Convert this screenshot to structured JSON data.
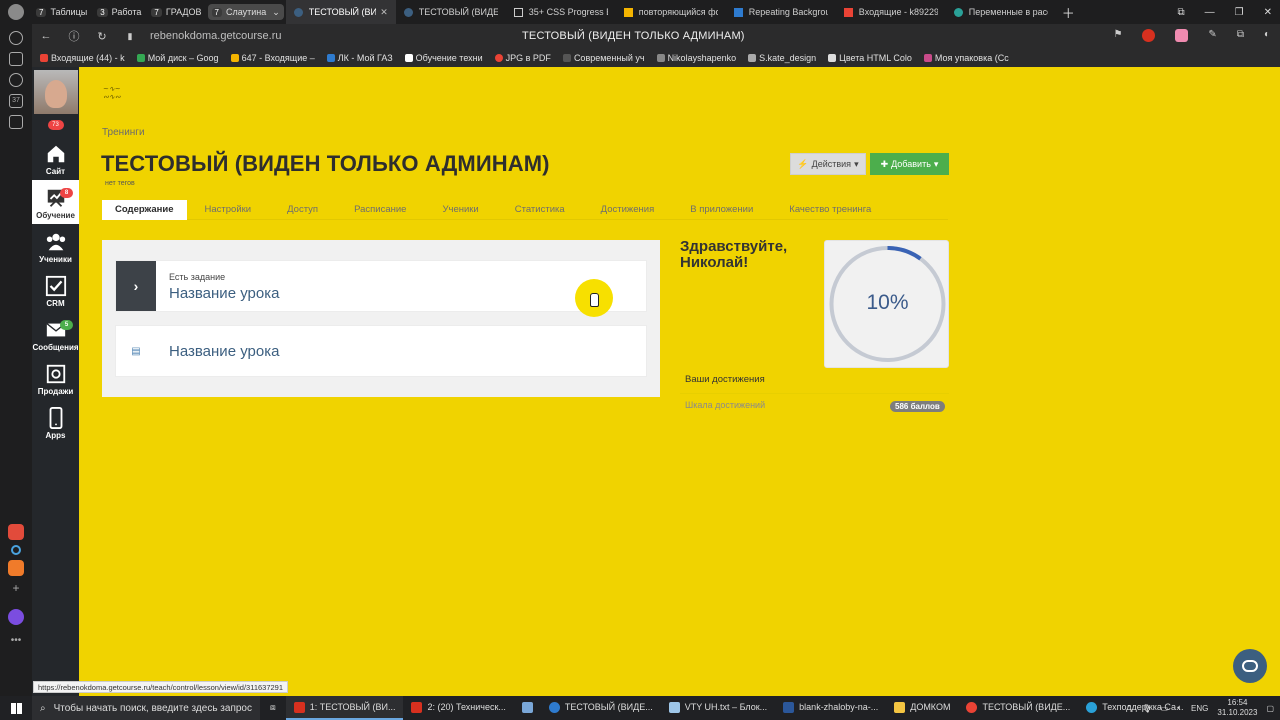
{
  "browser": {
    "tab_groups": [
      {
        "num": "7",
        "label": "Таблицы"
      },
      {
        "num": "3",
        "label": "Работа"
      },
      {
        "num": "7",
        "label": "ГРАДОВ"
      },
      {
        "num": "7",
        "label": "Слаутина"
      }
    ],
    "tabs": [
      {
        "title": "ТЕСТОВЫЙ (ВИД",
        "active": true,
        "color": "#3c5f80"
      },
      {
        "title": "ТЕСТОВЫЙ (ВИДЕН",
        "active": false,
        "color": "#3c5f80"
      },
      {
        "title": "35+ CSS Progress Ba",
        "active": false,
        "color": "#cccccc"
      },
      {
        "title": "повторяющийся фо",
        "active": false,
        "color": "#f4b400"
      },
      {
        "title": "Repeating Backgrour",
        "active": false,
        "color": "#2e7bcf"
      },
      {
        "title": "Входящие - k89229(",
        "active": false,
        "color": "#ea4335"
      },
      {
        "title": "Переменные в расс",
        "active": false,
        "color": "#2aa198"
      }
    ],
    "url": "rebenokdoma.getcourse.ru",
    "page_title": "ТЕСТОВЫЙ (ВИДЕН ТОЛЬКО АДМИНАМ)",
    "bookmarks": [
      {
        "label": "Входящие (44) - k",
        "color": "#ea4335"
      },
      {
        "label": "Мой диск – Goog",
        "color": "#34a853"
      },
      {
        "label": "647 - Входящие –",
        "color": "#f4b400"
      },
      {
        "label": "ЛК - Мой ГАЗ",
        "color": "#2e7bcf"
      },
      {
        "label": "Обучение техни",
        "color": "#ffffff"
      },
      {
        "label": "JPG в PDF",
        "color": "#ea4335"
      },
      {
        "label": "Современный уч",
        "color": "#555555"
      },
      {
        "label": "Nikolayshapenko",
        "color": "#888888"
      },
      {
        "label": "S.kate_design",
        "color": "#aaaaaa"
      },
      {
        "label": "Цвета HTML Colo",
        "color": "#dddddd"
      },
      {
        "label": "Моя упаковка (Сс",
        "color": "#c94b8a"
      }
    ]
  },
  "sidebar": {
    "avatar_badge": "73",
    "items": [
      {
        "label": "Сайт",
        "badge": "",
        "active": false
      },
      {
        "label": "Обучение",
        "badge": "8",
        "active": true
      },
      {
        "label": "Ученики",
        "badge": "",
        "active": false
      },
      {
        "label": "CRM",
        "badge": "",
        "active": false
      },
      {
        "label": "Сообщения",
        "badge": "5",
        "active": false
      },
      {
        "label": "Продажи",
        "badge": "",
        "active": false
      },
      {
        "label": "Apps",
        "badge": "",
        "active": false
      }
    ]
  },
  "page": {
    "breadcrumb": "Тренинги",
    "title": "ТЕСТОВЫЙ (ВИДЕН ТОЛЬКО АДМИНАМ)",
    "subtitle": "нет тегов",
    "actions_label": "Действия",
    "add_label": "Добавить",
    "tabs": [
      "Содержание",
      "Настройки",
      "Доступ",
      "Расписание",
      "Ученики",
      "Статистика",
      "Достижения",
      "В приложении",
      "Качество тренинга"
    ],
    "lessons": [
      {
        "task": "Есть задание",
        "name": "Название урока"
      },
      {
        "task": "",
        "name": "Название урока"
      }
    ],
    "greeting_line1": "Здравствуйте,",
    "greeting_line2": "Николай!",
    "progress_percent": 10,
    "progress_label": "10%",
    "achievements_title": "Ваши достижения",
    "achievements_scale": "Шкала достижений",
    "points_badge": "586 баллов",
    "status_url": "https://rebenokdoma.getcourse.ru/teach/control/lesson/view/id/311637291"
  },
  "colors": {
    "page_bg": "#f0d300",
    "sidebar_bg": "#24272b",
    "add_button": "#4cae4c",
    "progress_arc": "#3a63b5",
    "progress_track": "#c5cad3"
  },
  "taskbar": {
    "search_placeholder": "Чтобы начать поиск, введите здесь запрос",
    "apps": [
      {
        "label": "1: ТЕСТОВЫЙ (ВИ...",
        "color": "#d7301f",
        "active": true
      },
      {
        "label": "2: (20) Техническ...",
        "color": "#d7301f",
        "active": false
      },
      {
        "label": "",
        "color": "#7aa7d8",
        "active": false
      },
      {
        "label": "ТЕСТОВЫЙ (ВИДЕ...",
        "color": "#2e7bcf",
        "active": false
      },
      {
        "label": "VTY UH.txt – Блок...",
        "color": "#9ec6e8",
        "active": false
      },
      {
        "label": "blank-zhaloby-na-...",
        "color": "#2b579a",
        "active": false
      },
      {
        "label": "ДОМКОМ",
        "color": "#f4c542",
        "active": false
      },
      {
        "label": "ТЕСТОВЫЙ (ВИДЕ...",
        "color": "#ea4335",
        "active": false
      },
      {
        "label": "Техподдержка Са...",
        "color": "#2aa1d8",
        "active": false
      }
    ],
    "lang": "ENG",
    "time": "16:54",
    "date": "31.10.2023"
  }
}
